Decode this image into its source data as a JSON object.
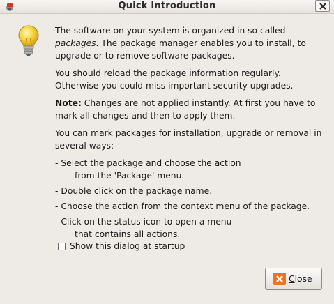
{
  "window": {
    "title": "Quick Introduction",
    "title_icon": "package-manager-icon",
    "close_icon": "close-x-icon"
  },
  "intro": {
    "icon": "lightbulb-icon",
    "para1_before": "The software on your system is organized in so called ",
    "para1_em": "packages",
    "para1_after": ". The package manager enables you to install, to upgrade or to remove software packages.",
    "para2": "You should reload the package information regularly. Otherwise you could miss important security upgrades.",
    "note_label": "Note:",
    "note_text": " Changes are not applied instantly. At first you have to mark all changes and then to apply them.",
    "ways_intro": "You can mark packages for installation, upgrade or removal in several ways:",
    "ways": [
      "- Select the package and choose the action",
      "from the 'Package' menu.",
      "- Double click on the package name.",
      "- Choose the action from the context menu of the package.",
      "- Click on the status icon to open a menu",
      "that contains all actions."
    ]
  },
  "startup_checkbox": {
    "label": "Show this dialog at startup",
    "checked": false
  },
  "close_button": {
    "label": "Close",
    "icon": "close-icon"
  },
  "colors": {
    "window_bg": "#eeebe7",
    "close_icon_bg": "#e8742a",
    "bulb_yellow": "#f6d23a"
  }
}
